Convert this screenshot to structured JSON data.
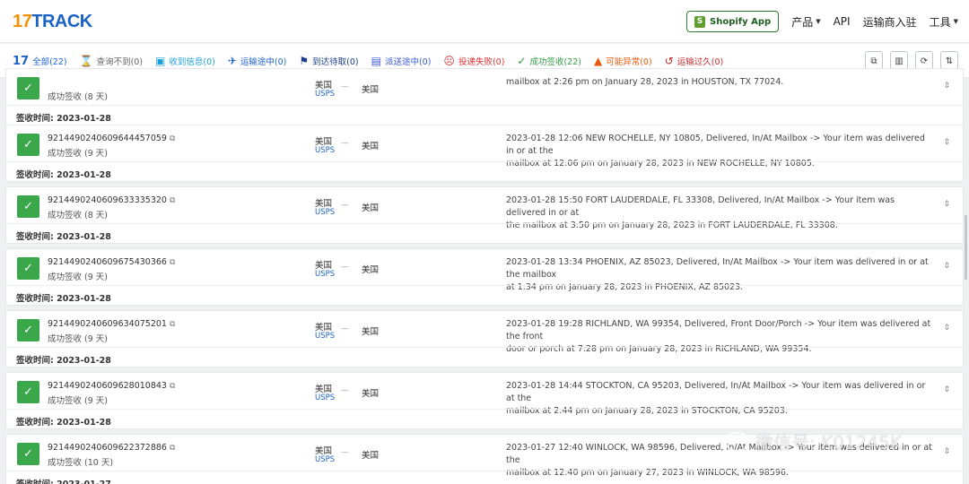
{
  "header": {
    "logo_prefix": "17",
    "logo_suffix": "TRACK",
    "shopify_label": "Shopify App",
    "nav": [
      {
        "label": "产品",
        "dropdown": true
      },
      {
        "label": "API",
        "dropdown": false
      },
      {
        "label": "运输商入驻",
        "dropdown": false
      },
      {
        "label": "工具",
        "dropdown": true
      }
    ]
  },
  "filters": [
    {
      "icon": "17",
      "label": "全部(22)",
      "color": "#1b62c7",
      "active": true,
      "icon_name": "all-icon"
    },
    {
      "icon": "⌛",
      "label": "查询不到(0)",
      "color": "#666666",
      "active": false,
      "icon_name": "hourglass-icon"
    },
    {
      "icon": "▣",
      "label": "收到信息(0)",
      "color": "#1a9fd6",
      "active": false,
      "icon_name": "info-received-icon"
    },
    {
      "icon": "✈",
      "label": "运输途中(0)",
      "color": "#1b62c7",
      "active": false,
      "icon_name": "plane-icon"
    },
    {
      "icon": "⚑",
      "label": "到达待取(0)",
      "color": "#1b3e8a",
      "active": false,
      "icon_name": "flag-icon"
    },
    {
      "icon": "▤",
      "label": "派送途中(0)",
      "color": "#3b5bdb",
      "active": false,
      "icon_name": "delivery-icon"
    },
    {
      "icon": "☹",
      "label": "投递失败(0)",
      "color": "#e03131",
      "active": false,
      "icon_name": "sad-face-icon"
    },
    {
      "icon": "✓",
      "label": "成功签收(22)",
      "color": "#2f9e44",
      "active": false,
      "icon_name": "check-icon"
    },
    {
      "icon": "▲",
      "label": "可能异常(0)",
      "color": "#e8590c",
      "active": false,
      "icon_name": "warning-icon"
    },
    {
      "icon": "↺",
      "label": "运输过久(0)",
      "color": "#c92a2a",
      "active": false,
      "icon_name": "clock-back-icon"
    }
  ],
  "tools": [
    {
      "icon": "⧉",
      "name": "copy-all-icon"
    },
    {
      "icon": "▥",
      "name": "export-icon"
    },
    {
      "icon": "⟳",
      "name": "refresh-icon"
    },
    {
      "icon": "⇅",
      "name": "sort-icon"
    }
  ],
  "shipments": [
    {
      "tracking_no": "",
      "status": "成功签收 (8 天)",
      "from": "美国",
      "carrier": "USPS",
      "to": "美国",
      "event_line1": "",
      "event_line2": "mailbox at 2:26 pm on January 28, 2023 in HOUSTON, TX 77024.",
      "signed": "签收时间: 2023-01-28"
    },
    {
      "tracking_no": "9214490240609644457059",
      "status": "成功签收 (9 天)",
      "from": "美国",
      "carrier": "USPS",
      "to": "美国",
      "event_line1": "2023-01-28 12:06  NEW ROCHELLE, NY 10805, Delivered, In/At Mailbox -> Your item was delivered in or at the",
      "event_line2": "mailbox at 12:06 pm on January 28, 2023 in NEW ROCHELLE, NY 10805.",
      "signed": "签收时间: 2023-01-28"
    },
    {
      "tracking_no": "9214490240609633335320",
      "status": "成功签收 (8 天)",
      "from": "美国",
      "carrier": "USPS",
      "to": "美国",
      "event_line1": "2023-01-28 15:50  FORT LAUDERDALE, FL 33308, Delivered, In/At Mailbox -> Your item was delivered in or at",
      "event_line2": "the mailbox at 3:50 pm on January 28, 2023 in FORT LAUDERDALE, FL 33308.",
      "signed": "签收时间: 2023-01-28"
    },
    {
      "tracking_no": "9214490240609675430366",
      "status": "成功签收 (9 天)",
      "from": "美国",
      "carrier": "USPS",
      "to": "美国",
      "event_line1": "2023-01-28 13:34  PHOENIX, AZ 85023, Delivered, In/At Mailbox -> Your item was delivered in or at the mailbox",
      "event_line2": "at 1:34 pm on January 28, 2023 in PHOENIX, AZ 85023.",
      "signed": "签收时间: 2023-01-28"
    },
    {
      "tracking_no": "9214490240609634075201",
      "status": "成功签收 (9 天)",
      "from": "美国",
      "carrier": "USPS",
      "to": "美国",
      "event_line1": "2023-01-28 19:28  RICHLAND, WA 99354, Delivered, Front Door/Porch -> Your item was delivered at the front",
      "event_line2": "door or porch at 7:28 pm on January 28, 2023 in RICHLAND, WA 99354.",
      "signed": "签收时间: 2023-01-28"
    },
    {
      "tracking_no": "9214490240609628010843",
      "status": "成功签收 (9 天)",
      "from": "美国",
      "carrier": "USPS",
      "to": "美国",
      "event_line1": "2023-01-28 14:44  STOCKTON, CA 95203, Delivered, In/At Mailbox -> Your item was delivered in or at the",
      "event_line2": "mailbox at 2:44 pm on January 28, 2023 in STOCKTON, CA 95203.",
      "signed": "签收时间: 2023-01-28"
    },
    {
      "tracking_no": "9214490240609622372886",
      "status": "成功签收 (10 天)",
      "from": "美国",
      "carrier": "USPS",
      "to": "美国",
      "event_line1": "2023-01-27 12:40  WINLOCK, WA 98596, Delivered, In/At Mailbox -> Your item was delivered in or at the",
      "event_line2": "mailbox at 12:40 pm on January 27, 2023 in WINLOCK, WA 98596.",
      "signed": "签收时间: 2023-01-27"
    }
  ],
  "watermark": "微信号: K01245K"
}
